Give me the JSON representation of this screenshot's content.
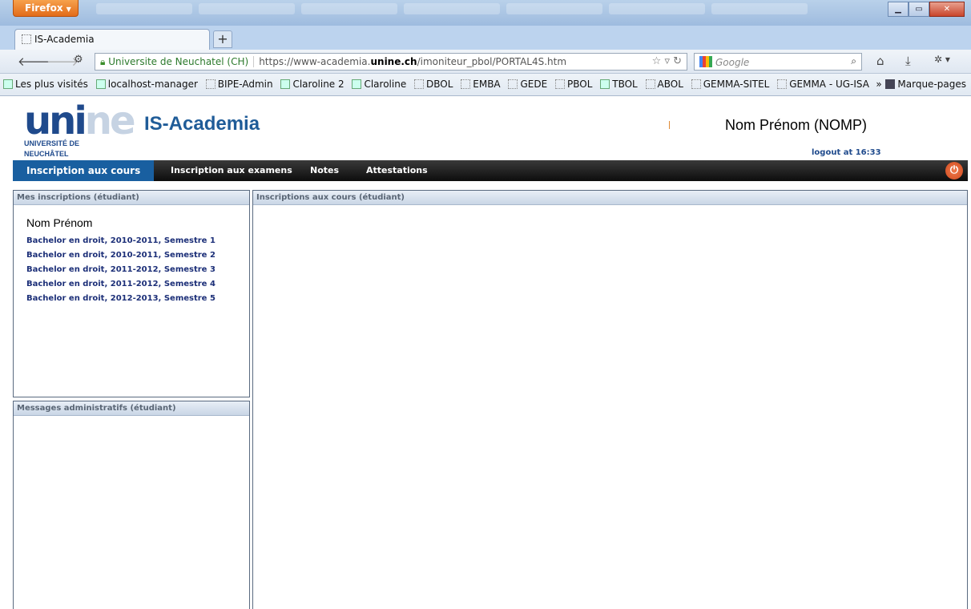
{
  "browser": {
    "menu_button": "Firefox",
    "tab_title": "IS-Academia",
    "new_tab": "+",
    "site_identity": "Universite de Neuchatel (CH)",
    "url_prefix": "https://www-academia.",
    "url_domain": "unine.ch",
    "url_path": "/imoniteur_pbol/PORTAL4S.htm",
    "search_placeholder": "Google",
    "bookmarks": [
      {
        "label": "Les plus visités"
      },
      {
        "label": "localhost-manager"
      },
      {
        "label": "BIPE-Admin"
      },
      {
        "label": "Claroline 2"
      },
      {
        "label": "Claroline"
      },
      {
        "label": "DBOL"
      },
      {
        "label": "EMBA"
      },
      {
        "label": "GEDE"
      },
      {
        "label": "PBOL"
      },
      {
        "label": "TBOL"
      },
      {
        "label": "ABOL"
      },
      {
        "label": "GEMMA-SITEL"
      },
      {
        "label": "GEMMA - UG-ISA"
      }
    ],
    "bookmarks_more": "»",
    "bookmarks_menu": "Marque-pages"
  },
  "page": {
    "logo": "unine",
    "logo_sub1": "UNIVERSITÉ DE",
    "logo_sub2": "NEUCHÂTEL",
    "app_title": "IS-Academia",
    "user_name": "Nom Prénom (NOMP)",
    "logout": "logout at 16:33",
    "menu": {
      "active": "Inscription aux cours",
      "items": [
        "Inscription aux examens",
        "Notes",
        "Attestations"
      ]
    },
    "left_panel_title": "Mes inscriptions (étudiant)",
    "student_name": "Nom Prénom",
    "inscriptions": [
      "Bachelor en droit, 2010-2011, Semestre 1",
      "Bachelor en droit, 2010-2011, Semestre 2",
      "Bachelor en droit, 2011-2012, Semestre 3",
      "Bachelor en droit, 2011-2012, Semestre 4",
      "Bachelor en droit, 2012-2013, Semestre 5"
    ],
    "messages_panel_title": "Messages administratifs (étudiant)",
    "main_panel_title": "Inscriptions aux cours (étudiant)"
  }
}
